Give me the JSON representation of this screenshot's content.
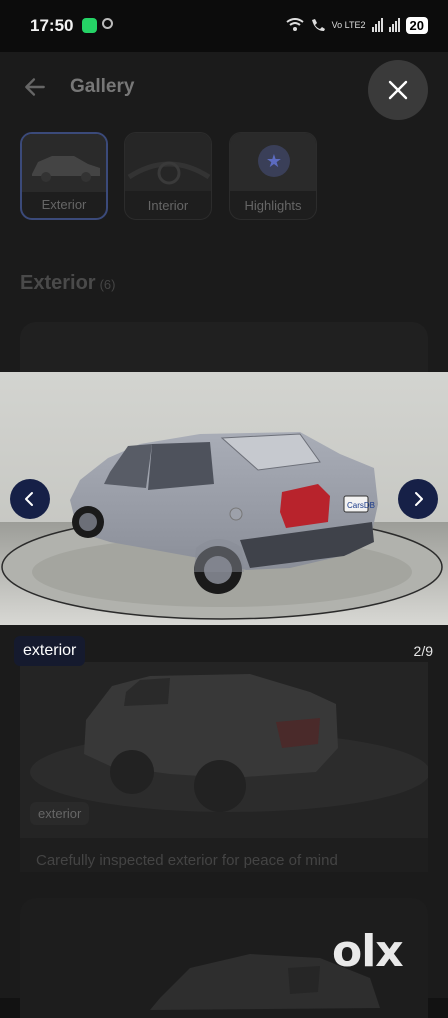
{
  "status_bar": {
    "time": "17:50",
    "battery": "20",
    "network": "Vo LTE2"
  },
  "header": {
    "title": "Gallery"
  },
  "tabs": [
    {
      "label": "Exterior",
      "active": true
    },
    {
      "label": "Interior",
      "active": false
    },
    {
      "label": "Highlights",
      "active": false
    }
  ],
  "section": {
    "title": "Exterior",
    "count": "(6)"
  },
  "viewer": {
    "tag": "exterior",
    "counter": "2/9",
    "watermark": "CarsDB"
  },
  "card": {
    "tag": "exterior",
    "caption": "Carefully inspected exterior for peace of mind"
  },
  "brand": {
    "logo": "olx"
  },
  "colors": {
    "nav_button": "#162047",
    "tag_bg": "#151a2e",
    "active_tab_border": "#3b4a7a"
  }
}
